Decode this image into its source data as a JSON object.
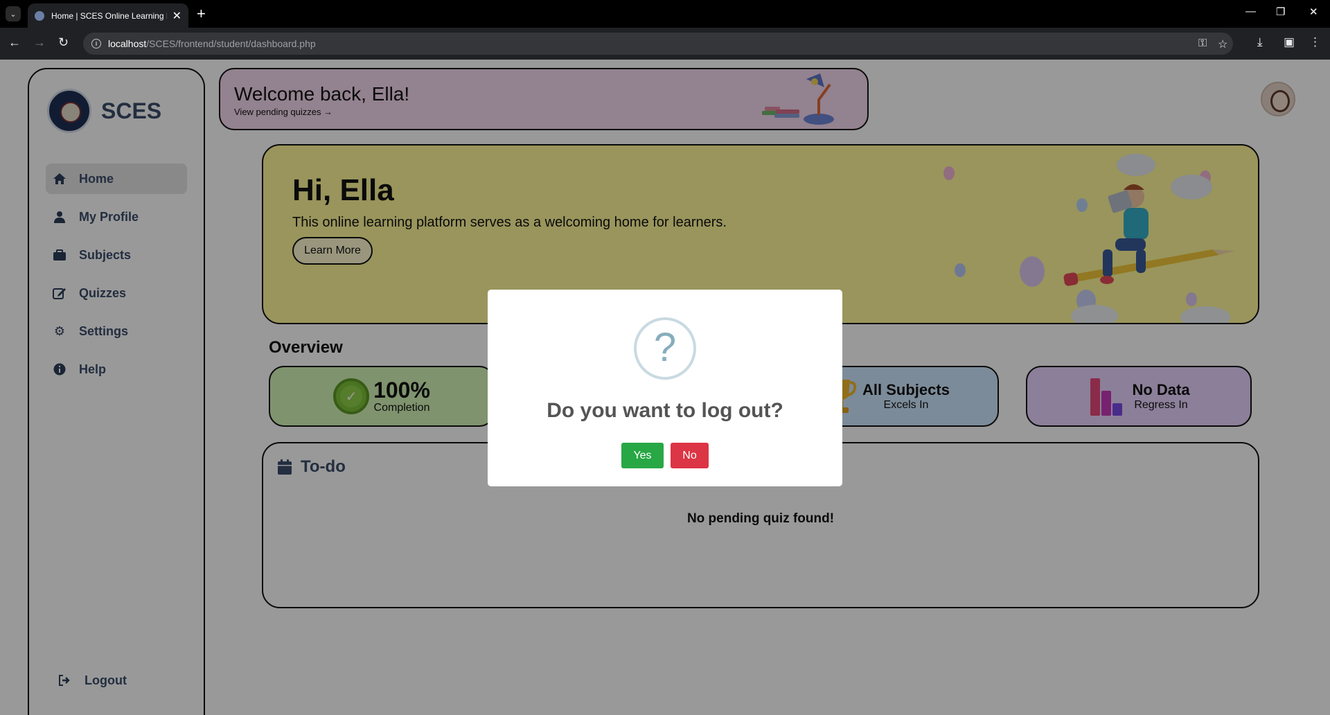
{
  "browser": {
    "tab_title": "Home | SCES Online Learning P",
    "url_host": "localhost",
    "url_path": "/SCES/frontend/student/dashboard.php"
  },
  "sidebar": {
    "brand": "SCES",
    "items": [
      {
        "label": "Home",
        "icon": "home-icon"
      },
      {
        "label": "My Profile",
        "icon": "user-icon"
      },
      {
        "label": "Subjects",
        "icon": "briefcase-icon"
      },
      {
        "label": "Quizzes",
        "icon": "edit-icon"
      },
      {
        "label": "Settings",
        "icon": "gear-icon"
      },
      {
        "label": "Help",
        "icon": "info-icon"
      }
    ],
    "logout_label": "Logout"
  },
  "welcome": {
    "title": "Welcome back, Ella!",
    "link": "View pending quizzes →"
  },
  "hero": {
    "title": "Hi, Ella",
    "subtitle": "This online learning platform serves as a welcoming home for learners.",
    "button": "Learn More"
  },
  "overview": {
    "title": "Overview",
    "stats": [
      {
        "main": "100%",
        "sub": "Completion",
        "color": "#d4f5b8"
      },
      {
        "main": "All Subjects",
        "sub": "Excels In",
        "color": "#cfe8ff"
      },
      {
        "main": "No Data",
        "sub": "Regress In",
        "color": "#e9d4ff"
      }
    ]
  },
  "todo": {
    "title": "To-do",
    "empty": "No pending quiz found!"
  },
  "modal": {
    "icon": "?",
    "title": "Do you want to log out?",
    "yes": "Yes",
    "no": "No"
  }
}
